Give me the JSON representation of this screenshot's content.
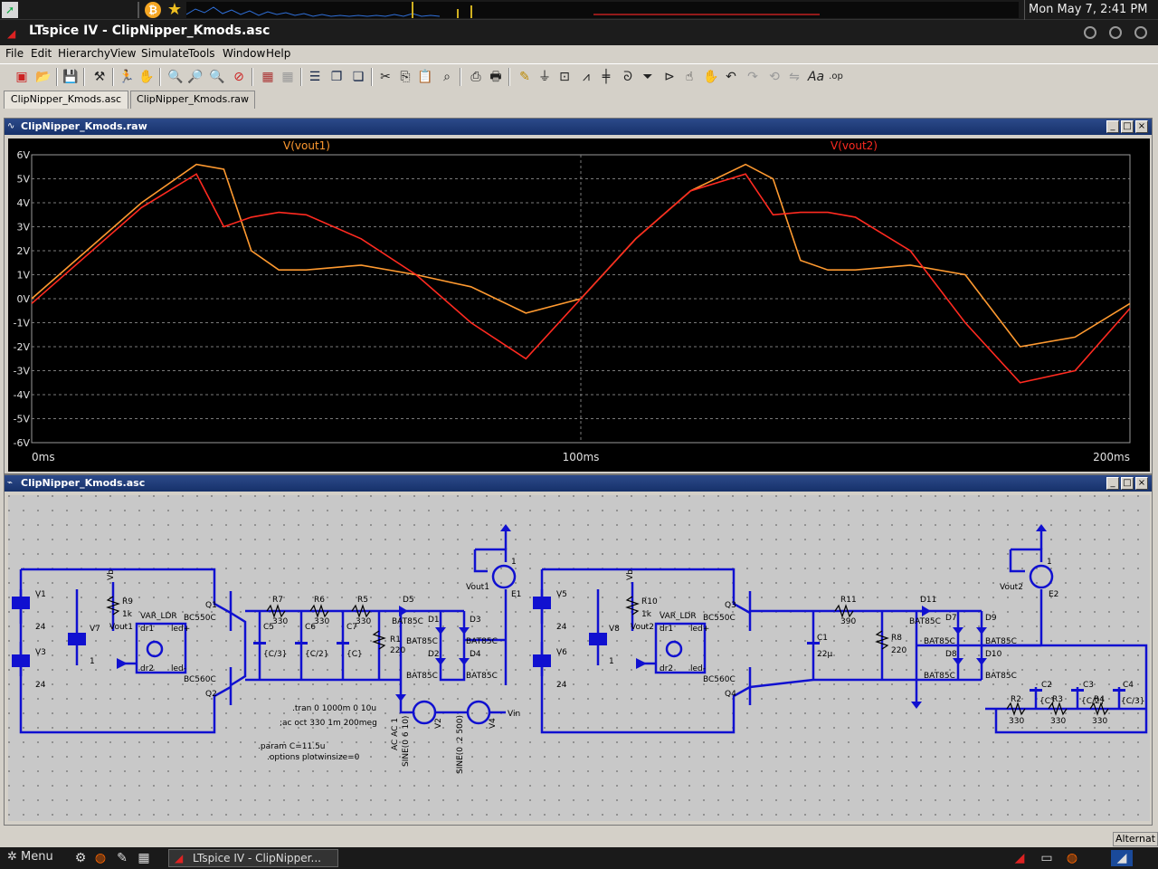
{
  "system_panel": {
    "clock": "Mon May  7,  2:41 PM"
  },
  "app": {
    "title": "LTspice IV - ClipNipper_Kmods.asc"
  },
  "menubar": [
    "File",
    "Edit",
    "Hierarchy",
    "View",
    "Simulate",
    "Tools",
    "Window",
    "Help"
  ],
  "tabs": [
    "ClipNipper_Kmods.asc",
    "ClipNipper_Kmods.raw"
  ],
  "waveform_window": {
    "title": "ClipNipper_Kmods.raw",
    "trace1_label": "V(vout1)",
    "trace2_label": "V(vout2)",
    "trace1_color": "#ff9a30",
    "trace2_color": "#ff2a20",
    "y_ticks": [
      "6V",
      "5V",
      "4V",
      "3V",
      "2V",
      "1V",
      "0V",
      "-1V",
      "-2V",
      "-3V",
      "-4V",
      "-5V",
      "-6V"
    ],
    "x_ticks": [
      "0ms",
      "100ms",
      "200ms"
    ]
  },
  "chart_data": {
    "type": "line",
    "title": "",
    "xlabel": "",
    "ylabel": "",
    "xlim": [
      0,
      200
    ],
    "ylim": [
      -6,
      6
    ],
    "x_unit": "ms",
    "y_unit": "V",
    "series": [
      {
        "name": "V(vout1)",
        "x": [
          0,
          10,
          20,
          30,
          35,
          40,
          45,
          50,
          60,
          70,
          80,
          90,
          100,
          110,
          120,
          130,
          135,
          140,
          145,
          150,
          160,
          170,
          180,
          190,
          200
        ],
        "y": [
          0,
          2.0,
          4.0,
          5.6,
          5.4,
          2.0,
          1.2,
          1.2,
          1.4,
          1.0,
          0.5,
          -0.6,
          0,
          2.5,
          4.5,
          5.6,
          5.0,
          1.6,
          1.2,
          1.2,
          1.4,
          1.0,
          -2.0,
          -1.6,
          -0.2
        ]
      },
      {
        "name": "V(vout2)",
        "x": [
          0,
          10,
          20,
          30,
          35,
          40,
          45,
          50,
          60,
          70,
          80,
          90,
          100,
          110,
          120,
          130,
          135,
          140,
          145,
          150,
          160,
          170,
          180,
          190,
          200
        ],
        "y": [
          -0.2,
          1.8,
          3.8,
          5.2,
          3.0,
          3.4,
          3.6,
          3.5,
          2.5,
          1.0,
          -1.0,
          -2.5,
          0,
          2.5,
          4.5,
          5.2,
          3.5,
          3.6,
          3.6,
          3.4,
          2.0,
          -1.0,
          -3.5,
          -3.0,
          -0.4
        ]
      }
    ],
    "grid": true,
    "legend": "top"
  },
  "schematic_window": {
    "title": "ClipNipper_Kmods.asc",
    "labels": {
      "v1": "V1",
      "v1_val": "24",
      "v3": "V3",
      "v3_val": "24",
      "v7": "V7",
      "v7_val": "1",
      "r9": "R9",
      "r9_val": "1k",
      "vout1_net": "Vout1",
      "var_ldr1": "VAR_LDR",
      "q1": "Q1",
      "q1_model": "BC550C",
      "q2": "Q2",
      "q2_model": "BC560C",
      "vb_net": "Vb",
      "r7": "R7",
      "r7_val": "330",
      "r6": "R6",
      "r6_val": "330",
      "r5": "R5",
      "r5_val": "330",
      "c5": "C5",
      "c5_val": "{C/3}",
      "c6": "C6",
      "c6_val": "{C/2}",
      "c7": "C7",
      "c7_val": "{C}",
      "d5": "D5",
      "d5_model": "BAT85C",
      "r1": "R1",
      "r1_val": "220",
      "d1": "D1",
      "d2": "D2",
      "d3": "D3",
      "d4": "D4",
      "diode_model": "BAT85C",
      "e1": "E1",
      "vout1_e": "Vout1",
      "tran": ".tran 0 1000m 0 10u",
      "ac": ";ac oct 330 1m 200meg",
      "param": ".param C=11.5u",
      "options": ".options plotwinsize=0",
      "v2": "V2",
      "v2_spec": "SINE(0 6 10)",
      "v2_ac": "AC AC 1",
      "v4": "V4",
      "v4_spec": "SINE(0 .2 500)",
      "vin_net": "Vin",
      "v5": "V5",
      "v5_val": "24",
      "v6": "V6",
      "v6_val": "24",
      "v8": "V8",
      "v8_val": "1",
      "r10": "R10",
      "r10_val": "1k",
      "vout2_net": "Vout2",
      "var_ldr2": "VAR_LDR",
      "q3": "Q3",
      "q3_model": "BC550C",
      "q4": "Q4",
      "q4_model": "BC560C",
      "r11": "R11",
      "r11_val": "390",
      "c1": "C1",
      "c1_val": "22µ",
      "r8": "R8",
      "r8_val": "220",
      "d11": "D11",
      "d11_model": "BAT85C",
      "d7": "D7",
      "d8": "D8",
      "d9": "D9",
      "d10": "D10",
      "e2": "E2",
      "vout2_e": "Vout2",
      "c2": "C2",
      "c2_val": "{C}",
      "c3": "C3",
      "c3_val": "{C/2}",
      "c4": "C4",
      "c4_val": "{C/3}",
      "r2": "R2",
      "r2_val": "330",
      "r3": "R3",
      "r3_val": "330",
      "r4": "R4",
      "r4_val": "330",
      "ldr_dr1": "dr1",
      "ldr_dr2": "dr2",
      "ldr_led_p": "led+",
      "ldr_led_m": "led-",
      "e_pin": "1"
    }
  },
  "statusbar": {
    "right": "Alternat"
  },
  "taskbar": {
    "menu": "Menu",
    "task_label": "LTspice IV - ClipNipper..."
  }
}
